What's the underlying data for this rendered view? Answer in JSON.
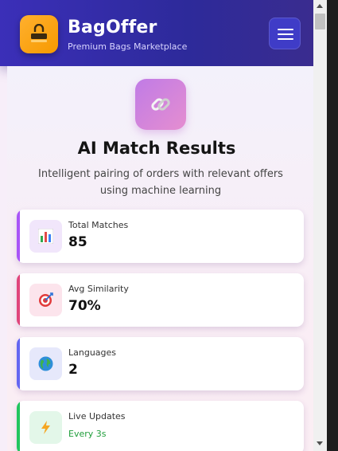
{
  "header": {
    "brand_title": "BagOffer",
    "brand_subtitle": "Premium Bags Marketplace",
    "logo_icon": "bag-icon",
    "menu_icon": "hamburger-menu-icon"
  },
  "hero": {
    "icon": "link-icon",
    "title": "AI Match Results",
    "subtitle": "Intelligent pairing of orders with relevant offers using machine learning"
  },
  "stats": [
    {
      "label": "Total Matches",
      "value": "85",
      "icon": "bar-chart-icon",
      "accent": "#a855f7"
    },
    {
      "label": "Avg Similarity",
      "value": "70%",
      "icon": "target-icon",
      "accent": "#e0457b"
    },
    {
      "label": "Languages",
      "value": "2",
      "icon": "globe-icon",
      "accent": "#6366f1"
    },
    {
      "label": "Live Updates",
      "value": "Every 3s",
      "icon": "lightning-icon",
      "accent": "#22c55e"
    }
  ],
  "colors": {
    "header_gradient_start": "#3b2fb8",
    "logo_orange": "#f79a00",
    "menu_button": "#3f3cc7",
    "live_green": "#1f9d3a"
  }
}
